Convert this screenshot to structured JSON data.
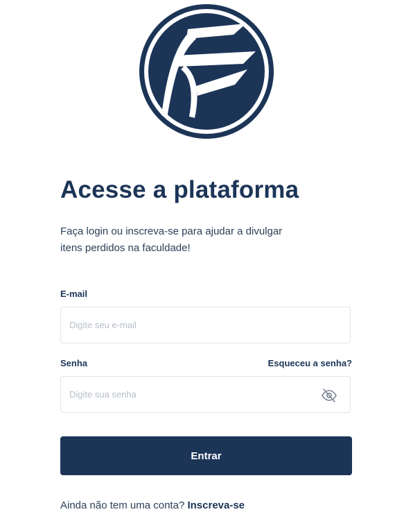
{
  "brand": {
    "logo_icon": "platform-logo-f-icon",
    "primary_color": "#1c3557"
  },
  "heading": {
    "title": "Acesse a plataforma",
    "subtitle": "Faça login ou inscreva-se para ajudar a divulgar itens perdidos na faculdade!"
  },
  "form": {
    "email_label": "E-mail",
    "email_placeholder": "Digite seu e-mail",
    "email_value": "",
    "password_label": "Senha",
    "password_placeholder": "Digite sua senha",
    "password_value": "",
    "forgot_password": "Esqueceu a senha?",
    "toggle_visibility_icon": "eye-slash-icon",
    "submit_label": "Entrar"
  },
  "footer": {
    "signup_prompt": "Ainda não tem uma conta?",
    "signup_link": "Inscreva-se"
  }
}
